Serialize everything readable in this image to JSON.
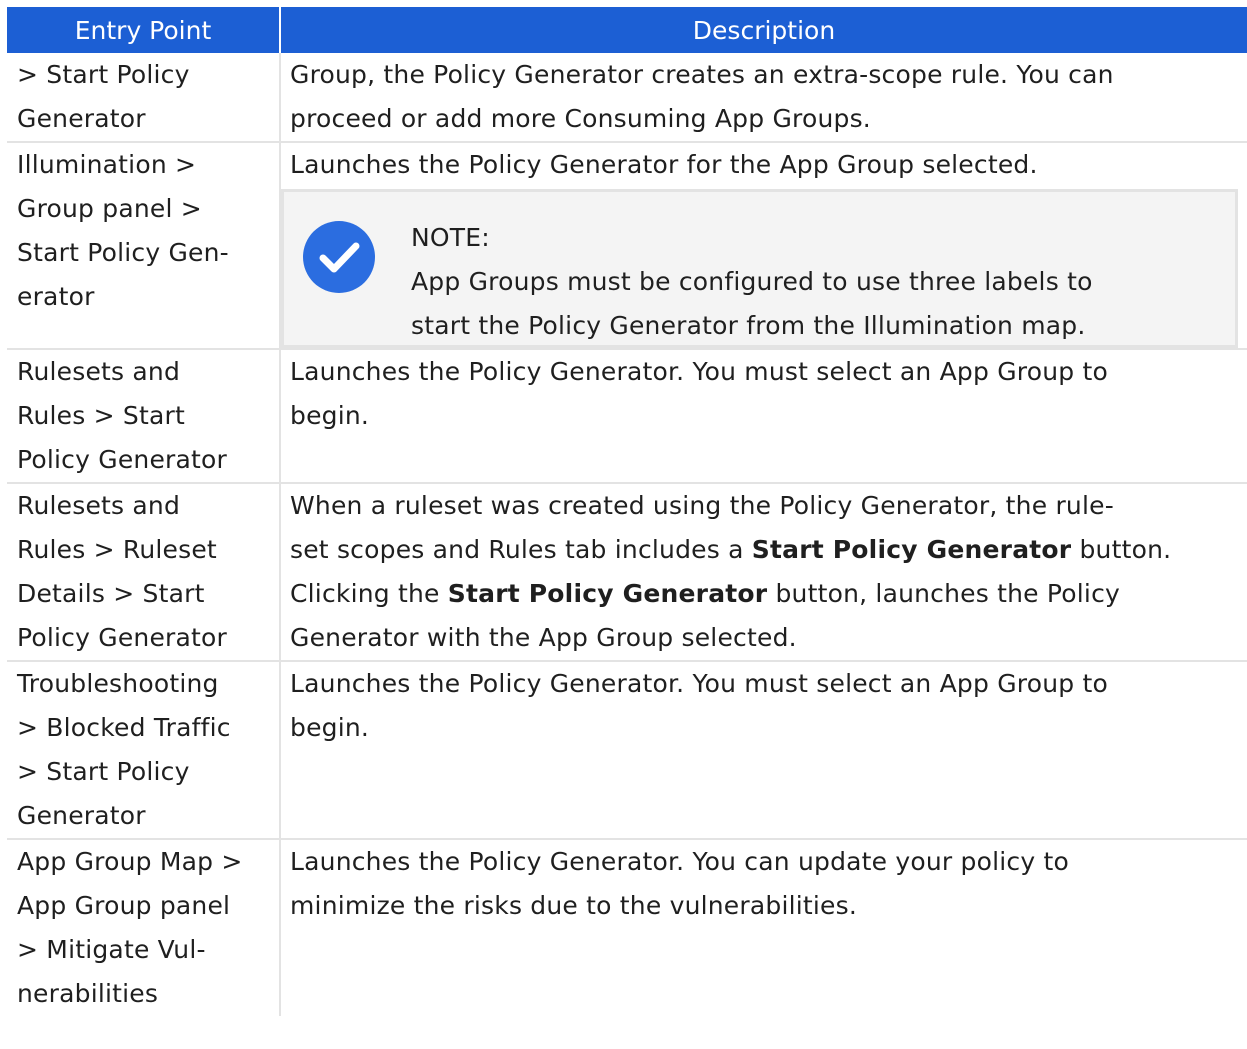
{
  "table": {
    "headers": [
      "Entry Point",
      "Description"
    ],
    "rows": [
      {
        "entry_lines": [
          "> Start Policy",
          "Generator"
        ],
        "desc_lines": [
          "Group, the Policy Generator creates an extra-scope rule. You can",
          "proceed or add more Consuming App Groups."
        ]
      },
      {
        "entry_lines": [
          "Illumination >",
          "Group panel >",
          "Start Policy Gen-",
          "erator"
        ],
        "desc_lines": [
          "Launches the Policy Generator for the App Group selected."
        ],
        "note": {
          "title": "NOTE:",
          "lines": [
            "App Groups must be configured to use three labels to",
            "start the Policy Generator from the Illumination map."
          ],
          "icon": "check-circle-icon"
        }
      },
      {
        "entry_lines": [
          "Rulesets and",
          "Rules > Start",
          "Policy Generator"
        ],
        "desc_lines": [
          "Launches the Policy Generator. You must select an App Group to",
          "begin."
        ]
      },
      {
        "entry_lines": [
          "Rulesets and",
          "Rules > Ruleset",
          "Details > Start",
          "Policy Generator"
        ],
        "desc": {
          "l1": "When a ruleset was created using the Policy Generator, the rule-",
          "l2_pre": "set scopes and Rules tab includes a ",
          "l2_bold": "Start Policy Generator",
          "l2_post": " button.",
          "l3_pre": "Clicking the ",
          "l3_bold": "Start Policy Generator",
          "l3_post": " button, launches the Policy",
          "l4": "Generator with the App Group selected."
        }
      },
      {
        "entry_lines": [
          "Troubleshooting",
          "> Blocked Traffic",
          "> Start Policy",
          "Generator"
        ],
        "desc_lines": [
          "Launches the Policy Generator. You must select an App Group to",
          "begin."
        ]
      },
      {
        "entry_lines": [
          "App Group Map >",
          "App Group panel",
          "> Mitigate Vul-",
          "nerabilities"
        ],
        "desc_lines": [
          "Launches the Policy Generator. You can update your policy to",
          "minimize the risks due to the vulnerabilities."
        ]
      }
    ]
  },
  "colors": {
    "header_bg": "#1c5fd4",
    "note_icon": "#2b6de0",
    "note_bg": "#f4f4f4",
    "border": "#e3e3e3"
  }
}
